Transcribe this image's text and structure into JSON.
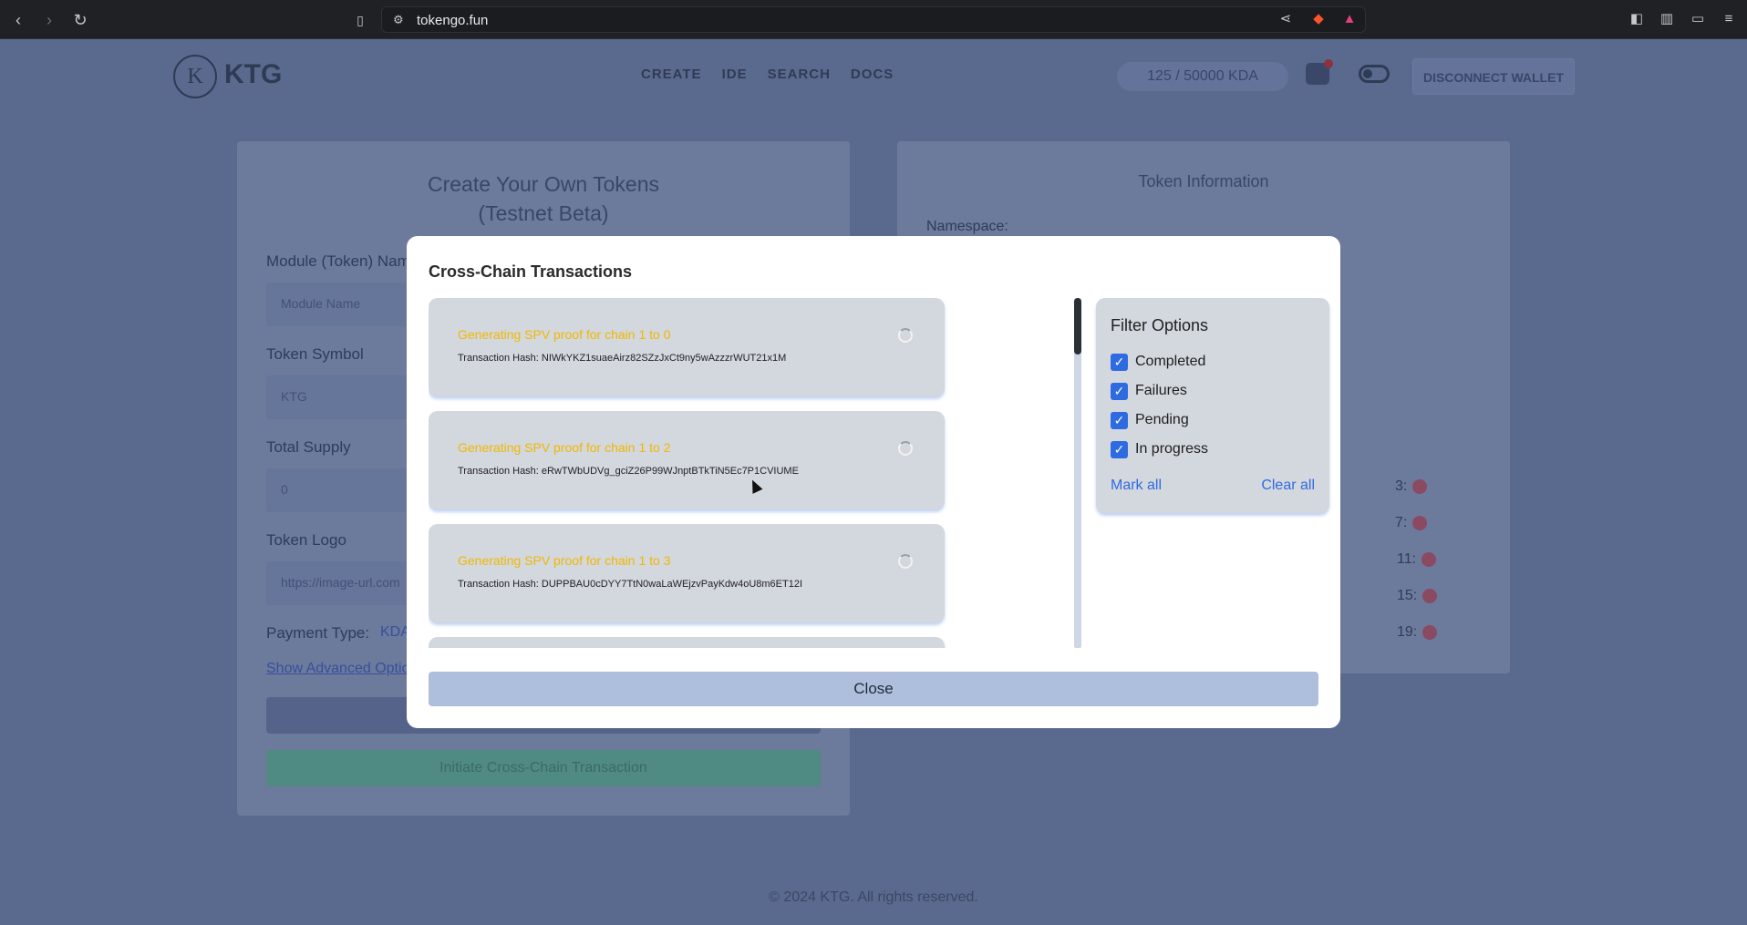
{
  "browser": {
    "url": "tokengo.fun"
  },
  "header": {
    "logo_letter": "K",
    "logo_text": "KTG",
    "nav": [
      "CREATE",
      "IDE",
      "SEARCH",
      "DOCS"
    ],
    "balance": "125 / 50000 KDA",
    "disconnect_label": "DISCONNECT WALLET"
  },
  "create_card": {
    "title_line1": "Create Your Own Tokens",
    "title_line2": "(Testnet Beta)",
    "module_label": "Module (Token) Name",
    "module_placeholder": "Module Name",
    "symbol_label": "Token Symbol",
    "symbol_value": "KTG",
    "supply_label": "Total Supply",
    "supply_value": "0",
    "logo_label": "Token Logo",
    "logo_placeholder": "https://image-url.com",
    "payment_label": "Payment Type:",
    "payment_value": "KDA",
    "advanced_link": "Show Advanced Options",
    "initiate_label": "Initiate Cross-Chain Transaction"
  },
  "info_card": {
    "title": "Token Information",
    "namespace_label": "Namespace:",
    "chains": [
      "3:",
      "7:",
      "11:",
      "15:",
      "19:"
    ]
  },
  "footer": "© 2024 KTG. All rights reserved.",
  "modal": {
    "title": "Cross-Chain Transactions",
    "transactions": [
      {
        "status": "Generating SPV proof for chain 1 to 0",
        "hash": "Transaction Hash: NIWkYKZ1suaeAirz82SZzJxCt9ny5wAzzzrWUT21x1M"
      },
      {
        "status": "Generating SPV proof for chain 1 to 2",
        "hash": "Transaction Hash: eRwTWbUDVg_gciZ26P99WJnptBTkTiN5Ec7P1CVIUME"
      },
      {
        "status": "Generating SPV proof for chain 1 to 3",
        "hash": "Transaction Hash: DUPPBAU0cDYY7TtN0waLaWEjzvPayKdw4oU8m6ET12I"
      }
    ],
    "filter": {
      "title": "Filter Options",
      "options": [
        "Completed",
        "Failures",
        "Pending",
        "In progress"
      ],
      "check_glyph": "✓",
      "mark_all": "Mark all",
      "clear_all": "Clear all"
    },
    "close_label": "Close"
  }
}
